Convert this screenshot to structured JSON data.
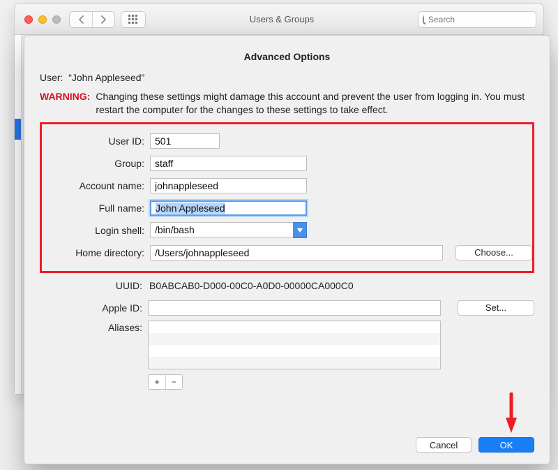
{
  "window": {
    "title": "Users & Groups",
    "search_placeholder": "Search"
  },
  "sheet": {
    "title": "Advanced Options",
    "user_label": "User:",
    "user_value": "“John Appleseed”",
    "warning_label": "WARNING:",
    "warning_text": "Changing these settings might damage this account and prevent the user from logging in. You must restart the computer for the changes to these settings to take effect.",
    "labels": {
      "user_id": "User ID:",
      "group": "Group:",
      "account_name": "Account name:",
      "full_name": "Full name:",
      "login_shell": "Login shell:",
      "home_dir": "Home directory:",
      "uuid": "UUID:",
      "apple_id": "Apple ID:",
      "aliases": "Aliases:"
    },
    "values": {
      "user_id": "501",
      "group": "staff",
      "account_name": "johnappleseed",
      "full_name": "John Appleseed",
      "login_shell": "/bin/bash",
      "home_dir": "/Users/johnappleseed",
      "uuid": "B0ABCAB0-D000-00C0-A0D0-00000CA000C0",
      "apple_id": ""
    },
    "buttons": {
      "choose": "Choose...",
      "set": "Set...",
      "add": "+",
      "remove": "−",
      "cancel": "Cancel",
      "ok": "OK"
    }
  }
}
